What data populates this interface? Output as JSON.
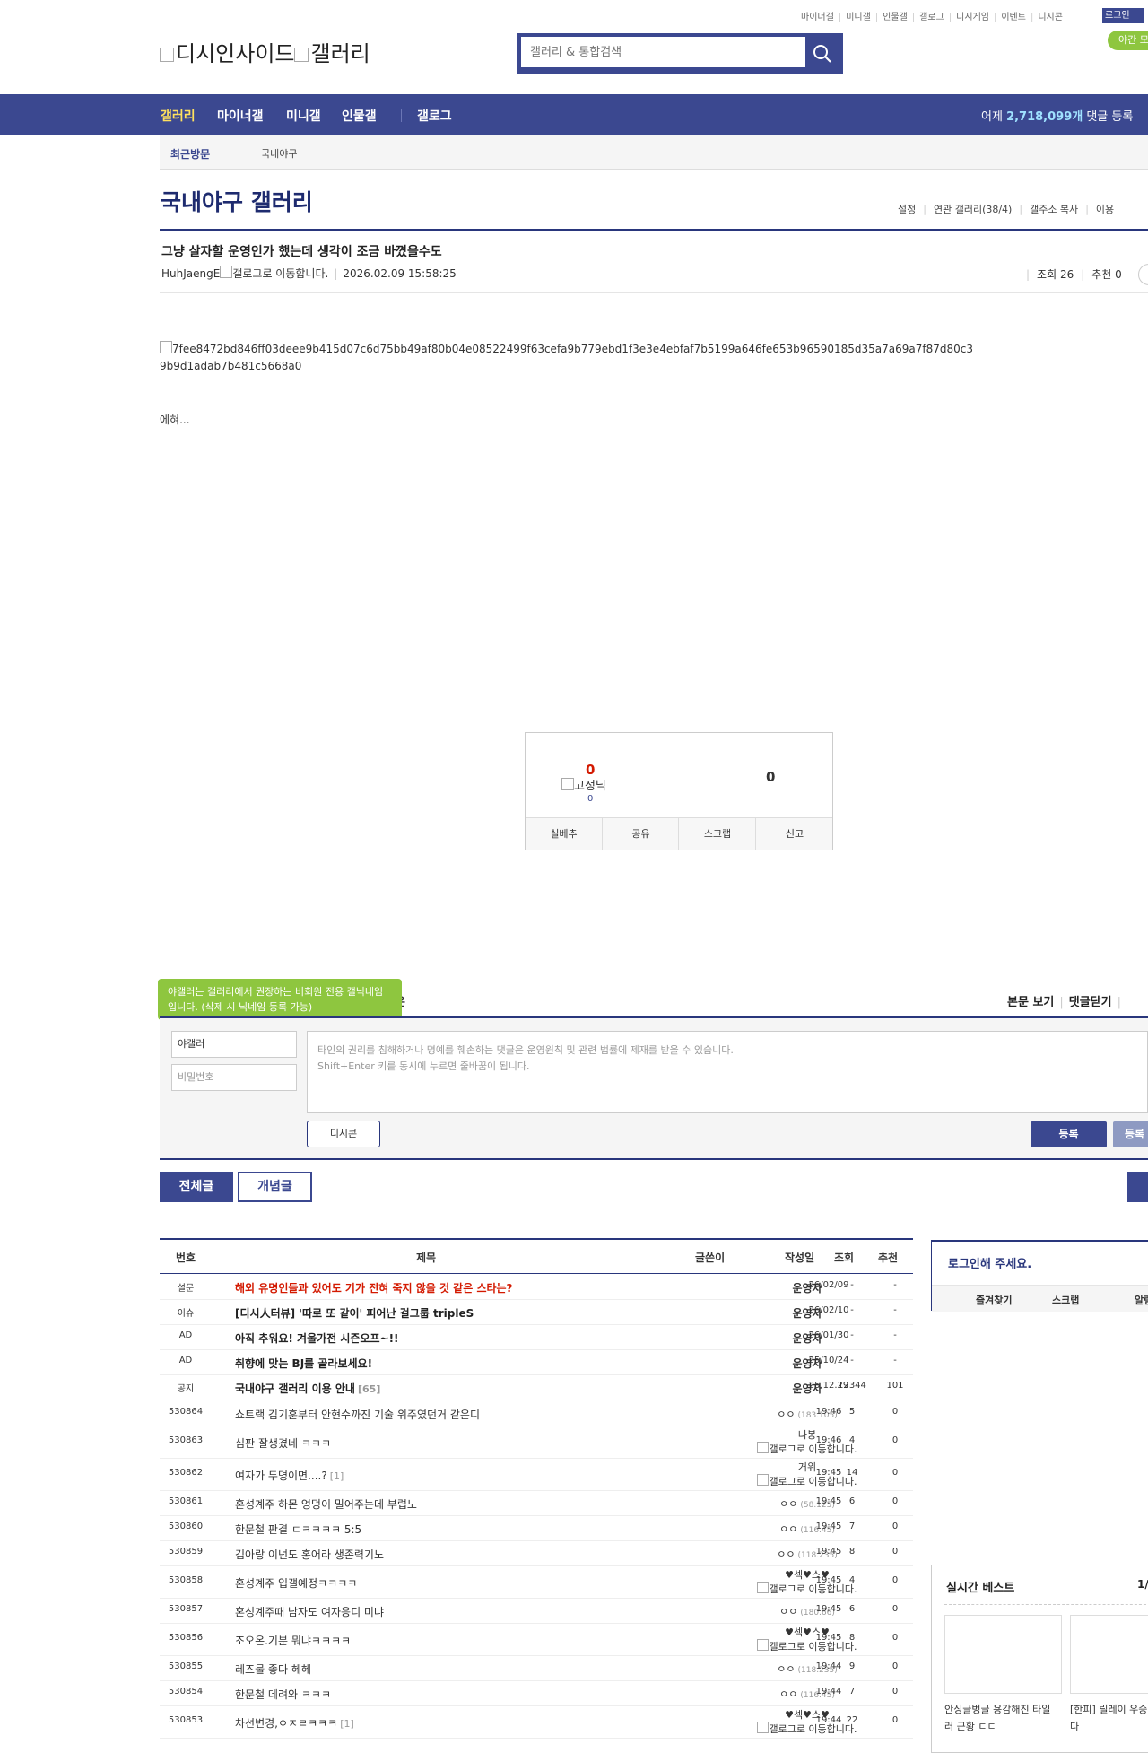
{
  "top_links": [
    "마이너갤",
    "미니갤",
    "인물갤",
    "갤로그",
    "디시게임",
    "이벤트",
    "디시콘"
  ],
  "login_label": "로그인",
  "night_label": "야간 모",
  "logo_text": "디시인사이드",
  "logo_text2": "갤러리",
  "search_placeholder": "갤러리 & 통합검색",
  "nav": [
    "갤러리",
    "마이너갤",
    "미니갤",
    "인물갤",
    "갤로그"
  ],
  "nav_stat": {
    "prefix": "어제 ",
    "count": "2,718,099개",
    "suffix": " 댓글 등록"
  },
  "visit": {
    "label": "최근방문",
    "gallery": "국내야구"
  },
  "gallery_title": "국내야구 갤러리",
  "gallery_opts": [
    "설정",
    "연관 갤러리(38/4)",
    "갤주소 복사",
    "이용"
  ],
  "post": {
    "title": "그냥 살자할 운영인가 했는데 생각이 조금 바꼈을수도",
    "writer": "HuhJaengE",
    "gallog_alt": "갤로그로 이동합니다.",
    "date": "2026.02.09 15:58:25",
    "views": "조회 26",
    "recommends": "추천 0",
    "image_alt": "7fee8472bd846ff03deee9b415d07c6d75bb49af80b04e08522499f63cefa9b779ebd1f3e3e4ebfaf7b5199a646fe653b96590185d35a7a69a7f87d80c39b9d1adab7b481c5668a0",
    "body": "에혀..."
  },
  "reco": {
    "up": "0",
    "fix_nick": "고정닉",
    "fix_count": "0",
    "down": "0",
    "buttons": [
      "실베추",
      "공유",
      "스크랩",
      "신고"
    ]
  },
  "comment": {
    "tooltip": "야갤러는 갤러리에서 권장하는 비회원 전용 갤닉네임입니다. (삭제 시 닉네임 등록 가능)",
    "hidden_head": "은",
    "links": [
      "본문 보기",
      "댓글닫기"
    ],
    "nick": "야갤러",
    "password_placeholder": "비밀번호",
    "textarea": "타인의 권리를 침해하거나 명예를 훼손하는 댓글은 운영원칙 및 관련 법률에 제재를 받을 수 있습니다.\nShift+Enter 키를 동시에 누르면 줄바꿈이 됩니다.",
    "dccon": "디시콘",
    "submit": "등록",
    "submit2": "등록"
  },
  "tabs": {
    "all": "전체글",
    "concept": "개념글"
  },
  "list_headers": {
    "num": "번호",
    "title": "제목",
    "writer": "글쓴이",
    "date": "작성일",
    "views": "조회",
    "reco": "추천"
  },
  "rows": [
    {
      "num": "설문",
      "title": "해외 유명인들과 있어도 기가 전혀 죽지 않을 것 같은 스타는?",
      "writer": "운영자",
      "ip": "",
      "date": "26/02/09",
      "views": "-",
      "reco": "-",
      "kind": "survey"
    },
    {
      "num": "이슈",
      "title": "[디시人터뷰] '따로 또 같이' 피어난 걸그룹 tripleS",
      "writer": "운영자",
      "ip": "",
      "date": "26/02/10",
      "views": "-",
      "reco": "-",
      "kind": "notice"
    },
    {
      "num": "AD",
      "title": "아직 추워요! 겨울가전 시즌오프~!!",
      "writer": "운영자",
      "ip": "",
      "date": "26/01/30",
      "views": "-",
      "reco": "-",
      "kind": "notice"
    },
    {
      "num": "AD",
      "title": "취향에 맞는 BJ를 골라보세요!",
      "writer": "운영자",
      "ip": "",
      "date": "25/10/24",
      "views": "-",
      "reco": "-",
      "kind": "notice"
    },
    {
      "num": "공지",
      "title": "국내야구 갤러리 이용 안내",
      "reply": "[65]",
      "writer": "운영자",
      "ip": "",
      "date": "25.12.29",
      "views": "12344",
      "reco": "101",
      "kind": "notice"
    },
    {
      "num": "530864",
      "title": "쇼트랙 김기훈부터 안현수까진 기술 위주였던거 같은디",
      "writer": "ㅇㅇ",
      "ip": "(183.105)",
      "date": "19:46",
      "views": "5",
      "reco": "0"
    },
    {
      "num": "530863",
      "title": "심판 잘생겼네 ㅋㅋㅋ",
      "writer": "나봉",
      "ip": "",
      "gallog": "갤로그로 이동합니다.",
      "date": "19:46",
      "views": "4",
      "reco": "0"
    },
    {
      "num": "530862",
      "title": "여자가 두명이면....?",
      "reply": "[1]",
      "writer": "거위",
      "ip": "",
      "gallog": "갤로그로 이동합니다.",
      "date": "19:45",
      "views": "14",
      "reco": "0"
    },
    {
      "num": "530861",
      "title": "혼성계주 하몬 엉덩이 밀어주는데 부럽노",
      "writer": "ㅇㅇ",
      "ip": "(58.125)",
      "date": "19:45",
      "views": "6",
      "reco": "0"
    },
    {
      "num": "530860",
      "title": "한문철 판결 ㄷㅋㅋㅋㅋ 5:5",
      "writer": "ㅇㅇ",
      "ip": "(116.45)",
      "date": "19:45",
      "views": "7",
      "reco": "0"
    },
    {
      "num": "530859",
      "title": "김아랑 이넌도 홍어라 생존력기노",
      "writer": "ㅇㅇ",
      "ip": "(118.235)",
      "date": "19:45",
      "views": "8",
      "reco": "0"
    },
    {
      "num": "530858",
      "title": "혼성계주 입갤예정ㅋㅋㅋㅋ",
      "writer": "♥섹♥스♥",
      "ip": "",
      "gallog": "갤로그로 이동합니다.",
      "date": "19:45",
      "views": "4",
      "reco": "0"
    },
    {
      "num": "530857",
      "title": "혼성계주때 남자도 여자응디 미냐",
      "writer": "ㅇㅇ",
      "ip": "(180.66)",
      "date": "19:45",
      "views": "6",
      "reco": "0"
    },
    {
      "num": "530856",
      "title": "조오온.기분 뭐냐ㅋㅋㅋㅋ",
      "writer": "♥섹♥스♥",
      "ip": "",
      "gallog": "갤로그로 이동합니다.",
      "date": "19:45",
      "views": "8",
      "reco": "0"
    },
    {
      "num": "530855",
      "title": "레즈물 좋다 헤헤",
      "writer": "ㅇㅇ",
      "ip": "(118.235)",
      "date": "19:44",
      "views": "9",
      "reco": "0"
    },
    {
      "num": "530854",
      "title": "한문철 데려와 ㅋㅋㅋ",
      "writer": "ㅇㅇ",
      "ip": "(116.45)",
      "date": "19:44",
      "views": "7",
      "reco": "0"
    },
    {
      "num": "530853",
      "title": "차선변경,ㅇㅈㄹㅋㅋㅋ",
      "reply": "[1]",
      "writer": "♥섹♥스♥",
      "ip": "",
      "gallog": "갤로그로 이동합니다.",
      "date": "19:44",
      "views": "22",
      "reco": "0"
    }
  ],
  "login_box": {
    "title": "로그인해 주세요.",
    "links": [
      "즐겨찾기",
      "스크랩",
      "알림"
    ]
  },
  "best": {
    "title": "실시간 베스트",
    "page": "1/",
    "captions": [
      "안싱글벙글 용감해진 타일러 근황 ㄷㄷ",
      "[한피] 릴레이 우승 표입니다"
    ]
  }
}
